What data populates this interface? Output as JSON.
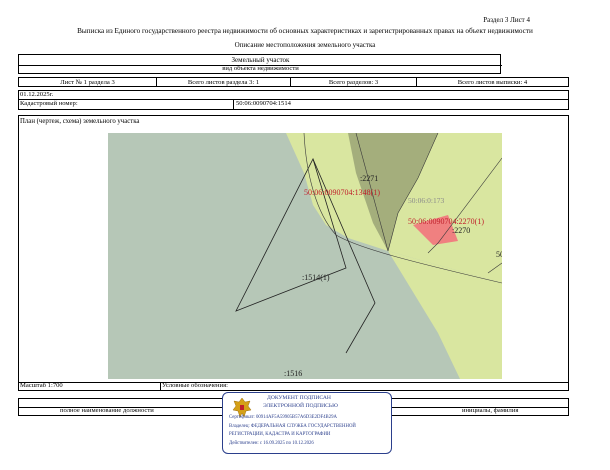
{
  "header": {
    "section_page": "Раздел 3    Лист 4",
    "title": "Выписка из Единого государственного реестра недвижимости об основных характеристиках и зарегистрированных правах на объект недвижимости",
    "subtitle": "Описание местоположения земельного участка"
  },
  "object": {
    "type": "Земельный участок",
    "type_caption": "вид объекта недвижимости"
  },
  "sheet_row": {
    "sheet": "Лист № 1 раздела 3",
    "sheets_in_section": "Всего листов раздела 3: 1",
    "sections_total": "Всего разделов: 3",
    "sheets_total": "Всего листов выписки: 4"
  },
  "date": "01.12.2025г.",
  "cadastral": {
    "label": "Кадастровый номер:",
    "value": "50:06:0090704:1514"
  },
  "plan_title": "План (чертеж, схема) земельного участка",
  "map": {
    "labels": {
      "parcel": ":1514(1)",
      "p1516": ":1516",
      "p2271": ":2271",
      "p2270": ":2270",
      "red1": "50:06:0090704:1348(1)",
      "red2": "50:06:0090704:2270(1)",
      "gray": "50:06:0:173",
      "edge": "50"
    },
    "colors": {
      "background": "#b6c7b7",
      "light_green": "#d9e6a0",
      "olive": "#a4ae7c",
      "red_fill": "#f08080",
      "red_text": "#c0202b"
    }
  },
  "footer": {
    "scale": "Масштаб 1:700",
    "legend": "Условные обозначения:",
    "position_caption": "полное наименование должности",
    "initials_caption": "инициалы, фамилия"
  },
  "stamp": {
    "line1": "ДОКУМЕНТ ПОДПИСАН",
    "line2": "ЭЛЕКТРОННОЙ ПОДПИСЬЮ",
    "cert": "Сертификат: 00914AF5A59905B57A6D3E2DF4B29A",
    "owner1": "Владелец: ФЕДЕРАЛЬНАЯ СЛУЖБА ГОСУДАРСТВЕННОЙ",
    "owner2": "РЕГИСТРАЦИИ, КАДАСТРА И КАРТОГРАФИИ",
    "valid": "Действителен: с 16.09.2025 по 10.12.2026"
  }
}
